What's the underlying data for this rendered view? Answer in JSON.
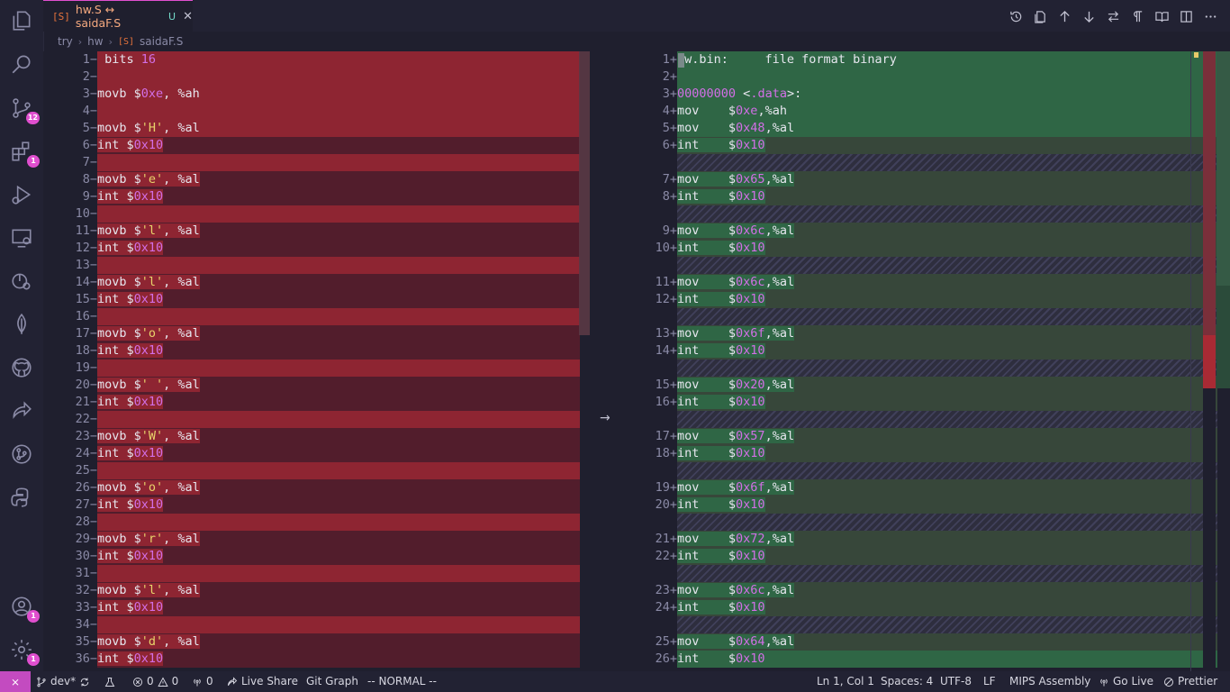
{
  "tab": {
    "icon": "[S]",
    "name": "hw.S ↔ saidaF.S",
    "status": "U",
    "close": "✕"
  },
  "breadcrumb": [
    "try",
    "hw",
    "saidaF.S"
  ],
  "breadcrumb_file_icon": "[S]",
  "activity_badges": {
    "source_control": "12",
    "extensions": "1",
    "accounts": "1",
    "settings": "1"
  },
  "left_lines": [
    {
      "n": "1",
      "m": "−",
      "t": "bits 16",
      "k": "dir",
      "bg": "full"
    },
    {
      "n": "2",
      "m": "−",
      "t": "",
      "bg": "full"
    },
    {
      "n": "3",
      "m": "−",
      "t": "movb $0xe, %ah",
      "k": "movnum",
      "bg": "full"
    },
    {
      "n": "4",
      "m": "−",
      "t": "",
      "bg": "full"
    },
    {
      "n": "5",
      "m": "−",
      "t": "movb $'H', %al",
      "k": "movstr",
      "bg": "full"
    },
    {
      "n": "6",
      "m": "−",
      "t": "int $0x10",
      "k": "int",
      "bg": "line"
    },
    {
      "n": "7",
      "m": "−",
      "t": "",
      "bg": "full"
    },
    {
      "n": "8",
      "m": "−",
      "t": "movb $'e', %al",
      "k": "movstr",
      "bg": "line"
    },
    {
      "n": "9",
      "m": "−",
      "t": "int $0x10",
      "k": "int",
      "bg": "line"
    },
    {
      "n": "10",
      "m": "−",
      "t": "",
      "bg": "full"
    },
    {
      "n": "11",
      "m": "−",
      "t": "movb $'l', %al",
      "k": "movstr",
      "bg": "line"
    },
    {
      "n": "12",
      "m": "−",
      "t": "int $0x10",
      "k": "int",
      "bg": "line"
    },
    {
      "n": "13",
      "m": "−",
      "t": "",
      "bg": "full"
    },
    {
      "n": "14",
      "m": "−",
      "t": "movb $'l', %al",
      "k": "movstr",
      "bg": "line"
    },
    {
      "n": "15",
      "m": "−",
      "t": "int $0x10",
      "k": "int",
      "bg": "line"
    },
    {
      "n": "16",
      "m": "−",
      "t": "",
      "bg": "full"
    },
    {
      "n": "17",
      "m": "−",
      "t": "movb $'o', %al",
      "k": "movstr",
      "bg": "line"
    },
    {
      "n": "18",
      "m": "−",
      "t": "int $0x10",
      "k": "int",
      "bg": "line"
    },
    {
      "n": "19",
      "m": "−",
      "t": "",
      "bg": "full"
    },
    {
      "n": "20",
      "m": "−",
      "t": "movb $' ', %al",
      "k": "movstr",
      "bg": "line"
    },
    {
      "n": "21",
      "m": "−",
      "t": "int $0x10",
      "k": "int",
      "bg": "line"
    },
    {
      "n": "22",
      "m": "−",
      "t": "",
      "bg": "full"
    },
    {
      "n": "23",
      "m": "−",
      "t": "movb $'W', %al",
      "k": "movstr",
      "bg": "line"
    },
    {
      "n": "24",
      "m": "−",
      "t": "int $0x10",
      "k": "int",
      "bg": "line"
    },
    {
      "n": "25",
      "m": "−",
      "t": "",
      "bg": "full"
    },
    {
      "n": "26",
      "m": "−",
      "t": "movb $'o', %al",
      "k": "movstr",
      "bg": "line"
    },
    {
      "n": "27",
      "m": "−",
      "t": "int $0x10",
      "k": "int",
      "bg": "line"
    },
    {
      "n": "28",
      "m": "−",
      "t": "",
      "bg": "full"
    },
    {
      "n": "29",
      "m": "−",
      "t": "movb $'r', %al",
      "k": "movstr",
      "bg": "line"
    },
    {
      "n": "30",
      "m": "−",
      "t": "int $0x10",
      "k": "int",
      "bg": "line"
    },
    {
      "n": "31",
      "m": "−",
      "t": "",
      "bg": "full"
    },
    {
      "n": "32",
      "m": "−",
      "t": "movb $'l', %al",
      "k": "movstr",
      "bg": "line"
    },
    {
      "n": "33",
      "m": "−",
      "t": "int $0x10",
      "k": "int",
      "bg": "line"
    },
    {
      "n": "34",
      "m": "−",
      "t": "",
      "bg": "full"
    },
    {
      "n": "35",
      "m": "−",
      "t": "movb $'d', %al",
      "k": "movstr",
      "bg": "line"
    },
    {
      "n": "36",
      "m": "−",
      "t": "int $0x10",
      "k": "int",
      "bg": "line"
    }
  ],
  "right_lines": [
    {
      "n": "1",
      "m": "+",
      "t": "hw.bin:     file format binary",
      "k": "hdr",
      "bg": "full"
    },
    {
      "n": "2",
      "m": "+",
      "t": "",
      "bg": "full"
    },
    {
      "n": "3",
      "m": "+",
      "t": "00000000 <.data>:",
      "k": "lbl",
      "bg": "full"
    },
    {
      "n": "4",
      "m": "+",
      "t": "mov    $0xe,%ah",
      "k": "mov",
      "bg": "full"
    },
    {
      "n": "5",
      "m": "+",
      "t": "mov    $0x48,%al",
      "k": "mov",
      "bg": "full"
    },
    {
      "n": "6",
      "m": "+",
      "t": "int    $0x10",
      "k": "int",
      "bg": "line"
    },
    {
      "n": "",
      "m": "",
      "t": "",
      "bg": "hatch"
    },
    {
      "n": "7",
      "m": "+",
      "t": "mov    $0x65,%al",
      "k": "mov",
      "bg": "line"
    },
    {
      "n": "8",
      "m": "+",
      "t": "int    $0x10",
      "k": "int",
      "bg": "line"
    },
    {
      "n": "",
      "m": "",
      "t": "",
      "bg": "hatch"
    },
    {
      "n": "9",
      "m": "+",
      "t": "mov    $0x6c,%al",
      "k": "mov",
      "bg": "line"
    },
    {
      "n": "10",
      "m": "+",
      "t": "int    $0x10",
      "k": "int",
      "bg": "line"
    },
    {
      "n": "",
      "m": "",
      "t": "",
      "bg": "hatch"
    },
    {
      "n": "11",
      "m": "+",
      "t": "mov    $0x6c,%al",
      "k": "mov",
      "bg": "line"
    },
    {
      "n": "12",
      "m": "+",
      "t": "int    $0x10",
      "k": "int",
      "bg": "line"
    },
    {
      "n": "",
      "m": "",
      "t": "",
      "bg": "hatch"
    },
    {
      "n": "13",
      "m": "+",
      "t": "mov    $0x6f,%al",
      "k": "mov",
      "bg": "line"
    },
    {
      "n": "14",
      "m": "+",
      "t": "int    $0x10",
      "k": "int",
      "bg": "line"
    },
    {
      "n": "",
      "m": "",
      "t": "",
      "bg": "hatch"
    },
    {
      "n": "15",
      "m": "+",
      "t": "mov    $0x20,%al",
      "k": "mov",
      "bg": "line"
    },
    {
      "n": "16",
      "m": "+",
      "t": "int    $0x10",
      "k": "int",
      "bg": "line"
    },
    {
      "n": "",
      "m": "",
      "t": "",
      "bg": "hatch"
    },
    {
      "n": "17",
      "m": "+",
      "t": "mov    $0x57,%al",
      "k": "mov",
      "bg": "line"
    },
    {
      "n": "18",
      "m": "+",
      "t": "int    $0x10",
      "k": "int",
      "bg": "line"
    },
    {
      "n": "",
      "m": "",
      "t": "",
      "bg": "hatch"
    },
    {
      "n": "19",
      "m": "+",
      "t": "mov    $0x6f,%al",
      "k": "mov",
      "bg": "line"
    },
    {
      "n": "20",
      "m": "+",
      "t": "int    $0x10",
      "k": "int",
      "bg": "line"
    },
    {
      "n": "",
      "m": "",
      "t": "",
      "bg": "hatch"
    },
    {
      "n": "21",
      "m": "+",
      "t": "mov    $0x72,%al",
      "k": "mov",
      "bg": "line"
    },
    {
      "n": "22",
      "m": "+",
      "t": "int    $0x10",
      "k": "int",
      "bg": "line"
    },
    {
      "n": "",
      "m": "",
      "t": "",
      "bg": "hatch"
    },
    {
      "n": "23",
      "m": "+",
      "t": "mov    $0x6c,%al",
      "k": "mov",
      "bg": "line"
    },
    {
      "n": "24",
      "m": "+",
      "t": "int    $0x10",
      "k": "int",
      "bg": "line"
    },
    {
      "n": "",
      "m": "",
      "t": "",
      "bg": "hatch"
    },
    {
      "n": "25",
      "m": "+",
      "t": "mov    $0x64,%al",
      "k": "mov",
      "bg": "line"
    },
    {
      "n": "26",
      "m": "+",
      "t": "int    $0x10",
      "k": "int",
      "bg": "full"
    }
  ],
  "status": {
    "branch": "dev*",
    "errors": "0",
    "warnings": "0",
    "ports": "0",
    "live_share": "Live Share",
    "git_graph": "Git Graph",
    "mode": "-- NORMAL --",
    "position": "Ln 1, Col 1",
    "spaces": "Spaces: 4",
    "encoding": "UTF-8",
    "eol": "LF",
    "language": "MIPS Assembly",
    "go_live": "Go Live",
    "prettier": "Prettier"
  },
  "colors": {
    "accent": "#e04fcf",
    "deleted": "#8e2532",
    "inserted": "#2f6645",
    "number": "#d26fe6",
    "string": "#e8d36a"
  }
}
